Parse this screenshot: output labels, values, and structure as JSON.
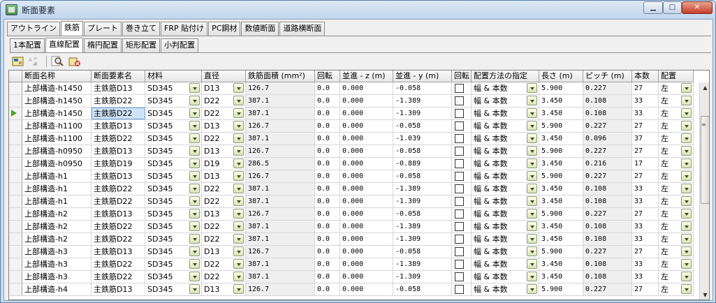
{
  "window": {
    "title": "断面要素"
  },
  "window_buttons": {
    "minimize": "▁",
    "maximize": "□",
    "close": "✕"
  },
  "tabs_main": [
    {
      "label": "アウトライン",
      "active": false
    },
    {
      "label": "鉄筋",
      "active": true
    },
    {
      "label": "プレート",
      "active": false
    },
    {
      "label": "巻き立て",
      "active": false
    },
    {
      "label": "FRP 貼付け",
      "active": false
    },
    {
      "label": "PC鋼材",
      "active": false
    },
    {
      "label": "数値断面",
      "active": false
    },
    {
      "label": "道路横断面",
      "active": false
    }
  ],
  "tabs_sub": [
    {
      "label": "1本配置",
      "active": false
    },
    {
      "label": "直線配置",
      "active": true
    },
    {
      "label": "楕円配置",
      "active": false
    },
    {
      "label": "矩形配置",
      "active": false
    },
    {
      "label": "小判配置",
      "active": false
    }
  ],
  "toolbar_icons": [
    "import-icon",
    "ab-rename-icon",
    "zoom-icon",
    "delete-icon"
  ],
  "grid": {
    "columns": [
      "断面名称",
      "断面要素名",
      "材料",
      "直径",
      "鉄筋面積 (mm²)",
      "回転",
      "並進 - z (m)",
      "並進 - y (m)",
      "回転",
      "配置方法の指定",
      "長さ (m)",
      "ピッチ (m)",
      "本数",
      "配置"
    ],
    "current_row": 2,
    "rows": [
      [
        "上部構造-h1450",
        "主鉄筋D13",
        "SD345",
        "D13",
        "126.7",
        "0.0",
        "0.000",
        "-0.058",
        "",
        "幅 & 本数",
        "5.900",
        "0.227",
        "27",
        "左"
      ],
      [
        "上部構造-h1450",
        "主鉄筋D22",
        "SD345",
        "D22",
        "387.1",
        "0.0",
        "0.000",
        "-1.389",
        "",
        "幅 & 本数",
        "3.450",
        "0.108",
        "33",
        "左"
      ],
      [
        "上部構造-h1450",
        "主鉄筋D22",
        "SD345",
        "D22",
        "387.1",
        "0.0",
        "0.000",
        "-1.309",
        "",
        "幅 & 本数",
        "3.450",
        "0.108",
        "33",
        "左"
      ],
      [
        "上部構造-h1100",
        "主鉄筋D13",
        "SD345",
        "D13",
        "126.7",
        "0.0",
        "0.000",
        "-0.058",
        "",
        "幅 & 本数",
        "5.900",
        "0.227",
        "27",
        "左"
      ],
      [
        "上部構造-h1100",
        "主鉄筋D22",
        "SD345",
        "D22",
        "387.1",
        "0.0",
        "0.000",
        "-1.039",
        "",
        "幅 & 本数",
        "3.450",
        "0.096",
        "37",
        "左"
      ],
      [
        "上部構造-h0950",
        "主鉄筋D13",
        "SD345",
        "D13",
        "126.7",
        "0.0",
        "0.000",
        "-0.058",
        "",
        "幅 & 本数",
        "5.900",
        "0.227",
        "27",
        "左"
      ],
      [
        "上部構造-h0950",
        "主鉄筋D19",
        "SD345",
        "D19",
        "286.5",
        "0.0",
        "0.000",
        "-0.889",
        "",
        "幅 & 本数",
        "3.450",
        "0.216",
        "17",
        "左"
      ],
      [
        "上部構造-h1",
        "主鉄筋D13",
        "SD345",
        "D13",
        "126.7",
        "0.0",
        "0.000",
        "-0.058",
        "",
        "幅 & 本数",
        "5.900",
        "0.227",
        "27",
        "左"
      ],
      [
        "上部構造-h1",
        "主鉄筋D22",
        "SD345",
        "D22",
        "387.1",
        "0.0",
        "0.000",
        "-1.389",
        "",
        "幅 & 本数",
        "3.450",
        "0.108",
        "33",
        "左"
      ],
      [
        "上部構造-h1",
        "主鉄筋D22",
        "SD345",
        "D22",
        "387.1",
        "0.0",
        "0.000",
        "-1.309",
        "",
        "幅 & 本数",
        "3.450",
        "0.108",
        "33",
        "左"
      ],
      [
        "上部構造-h2",
        "主鉄筋D13",
        "SD345",
        "D13",
        "126.7",
        "0.0",
        "0.000",
        "-0.058",
        "",
        "幅 & 本数",
        "5.900",
        "0.227",
        "27",
        "左"
      ],
      [
        "上部構造-h2",
        "主鉄筋D22",
        "SD345",
        "D22",
        "387.1",
        "0.0",
        "0.000",
        "-1.389",
        "",
        "幅 & 本数",
        "3.450",
        "0.108",
        "33",
        "左"
      ],
      [
        "上部構造-h2",
        "主鉄筋D22",
        "SD345",
        "D22",
        "387.1",
        "0.0",
        "0.000",
        "-1.309",
        "",
        "幅 & 本数",
        "3.450",
        "0.108",
        "33",
        "左"
      ],
      [
        "上部構造-h3",
        "主鉄筋D13",
        "SD345",
        "D13",
        "126.7",
        "0.0",
        "0.000",
        "-0.058",
        "",
        "幅 & 本数",
        "5.900",
        "0.227",
        "27",
        "左"
      ],
      [
        "上部構造-h3",
        "主鉄筋D22",
        "SD345",
        "D22",
        "387.1",
        "0.0",
        "0.000",
        "-1.389",
        "",
        "幅 & 本数",
        "3.450",
        "0.108",
        "33",
        "左"
      ],
      [
        "上部構造-h3",
        "主鉄筋D22",
        "SD345",
        "D22",
        "387.1",
        "0.0",
        "0.000",
        "-1.309",
        "",
        "幅 & 本数",
        "3.450",
        "0.108",
        "33",
        "左"
      ],
      [
        "上部構造-h4",
        "主鉄筋D13",
        "SD345",
        "D13",
        "126.7",
        "0.0",
        "0.000",
        "-0.058",
        "",
        "幅 & 本数",
        "5.900",
        "0.227",
        "27",
        "左"
      ]
    ]
  },
  "scrollbar": {
    "up": "▲",
    "down": "▼",
    "grip": "≡"
  }
}
